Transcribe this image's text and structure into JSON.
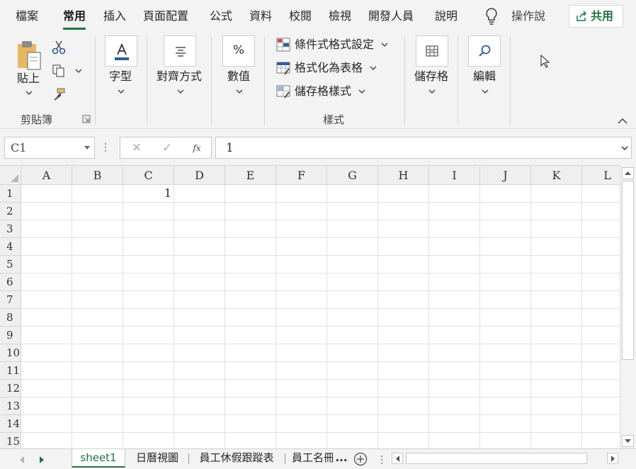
{
  "ribbon_tabs": [
    {
      "label": "檔案"
    },
    {
      "label": "常用",
      "active": true
    },
    {
      "label": "插入"
    },
    {
      "label": "頁面配置"
    },
    {
      "label": "公式"
    },
    {
      "label": "資料"
    },
    {
      "label": "校閱"
    },
    {
      "label": "檢視"
    },
    {
      "label": "開發人員"
    },
    {
      "label": "說明"
    }
  ],
  "tell_me": "操作說",
  "share_label": "共用",
  "clipboard": {
    "paste_label": "貼上",
    "group_label": "剪貼簿",
    "icons": [
      "paste-icon",
      "cut-icon",
      "copy-icon",
      "format-painter-icon"
    ]
  },
  "font_group": {
    "label": "字型",
    "icon": "font-color-icon"
  },
  "alignment_group": {
    "label": "對齊方式",
    "icon": "align-center-icon"
  },
  "number_group": {
    "label": "數值",
    "icon_text": "%"
  },
  "styles": {
    "conditional_formatting": "條件式格式設定",
    "format_as_table": "格式化為表格",
    "cell_styles": "儲存格樣式",
    "group_label": "樣式"
  },
  "cells_group": {
    "label": "儲存格",
    "icon": "cells-icon"
  },
  "editing_group": {
    "label": "編輯",
    "icon": "search-icon"
  },
  "formula_bar": {
    "name_box": "C1",
    "fx_label": "fx",
    "cancel_symbol": "✕",
    "enter_symbol": "✓",
    "value": "1"
  },
  "columns": [
    "A",
    "B",
    "C",
    "D",
    "E",
    "F",
    "G",
    "H",
    "I",
    "J",
    "K",
    "L"
  ],
  "rows": [
    "1",
    "2",
    "3",
    "4",
    "5",
    "6",
    "7",
    "8",
    "9",
    "10",
    "11",
    "12",
    "13",
    "14",
    "15"
  ],
  "cell_c1": "1",
  "sheets": [
    {
      "label": "sheet1",
      "active": true
    },
    {
      "label": "日曆視圖"
    },
    {
      "label": "員工休假跟蹤表"
    },
    {
      "label": "員工名冊"
    }
  ],
  "sheets_overflow": "...",
  "colors": {
    "accent": "#217346",
    "ribbon_bg": "#f3f3f3",
    "grid_line": "#e1e1e1"
  }
}
